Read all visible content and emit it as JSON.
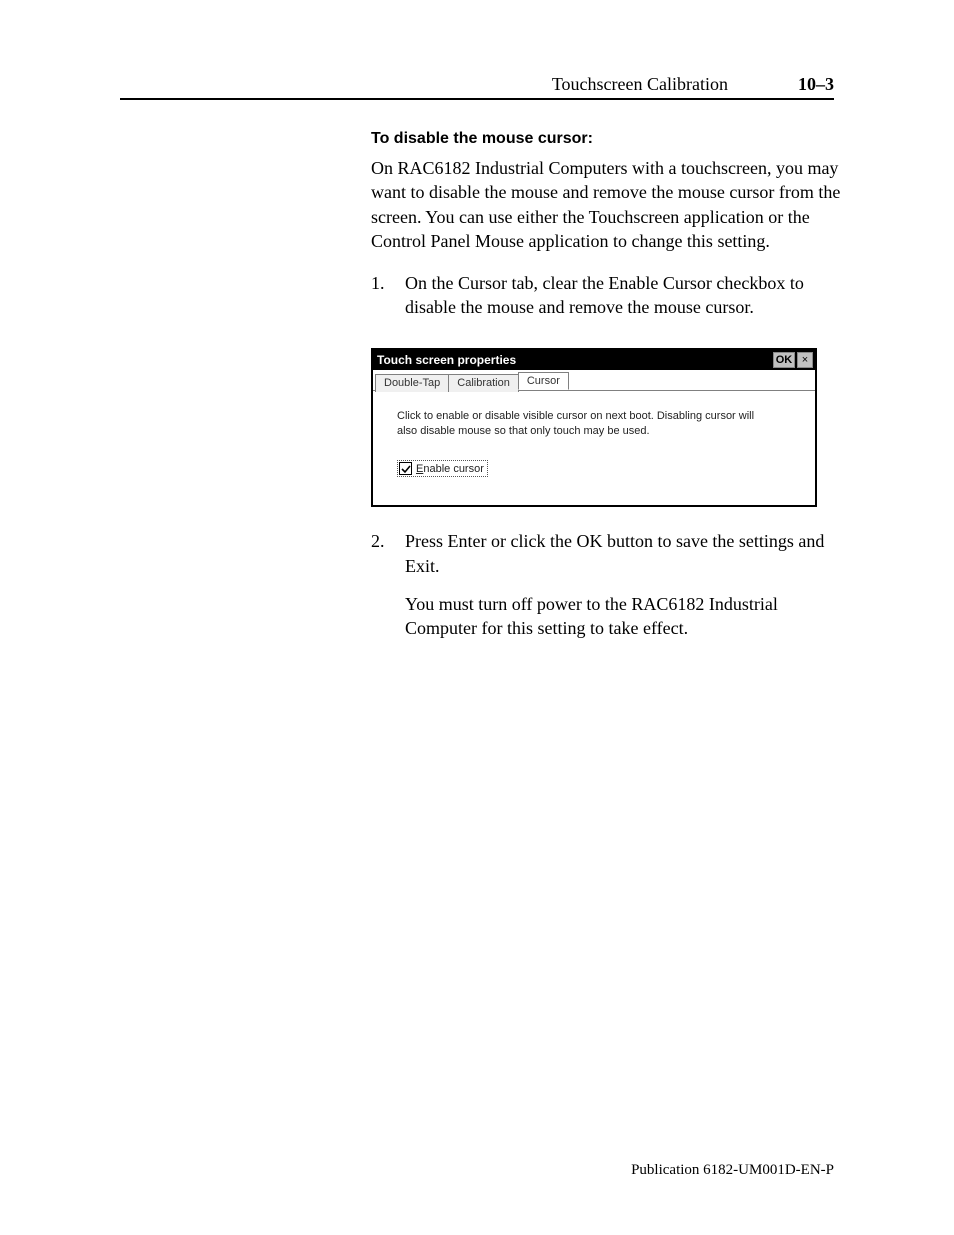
{
  "header": {
    "title": "Touchscreen Calibration",
    "page": "10–3"
  },
  "section": {
    "title": "To disable the mouse cursor:",
    "intro": "On RAC6182 Industrial Computers with a touchscreen, you may want to disable the mouse and remove the mouse cursor from the screen. You can use either the Touchscreen application or the Control Panel Mouse application to change this setting.",
    "steps": [
      {
        "num": "1.",
        "text": "On the Cursor tab, clear the Enable Cursor checkbox to disable the mouse and remove the mouse cursor."
      },
      {
        "num": "2.",
        "text": "Press Enter or click the OK button to save the settings and Exit.",
        "text2": "You must turn off power to the RAC6182 Industrial Computer for this setting to take effect."
      }
    ]
  },
  "dialog": {
    "title": "Touch screen properties",
    "ok": "OK",
    "close": "×",
    "tabs": [
      "Double-Tap",
      "Calibration",
      "Cursor"
    ],
    "active_tab": 2,
    "description": "Click to enable or disable visible cursor on next boot.  Disabling cursor will also disable mouse so that only touch may be used.",
    "checkbox": {
      "checked": true,
      "accel": "E",
      "rest": "nable cursor"
    }
  },
  "footer": "Publication 6182-UM001D-EN-P"
}
